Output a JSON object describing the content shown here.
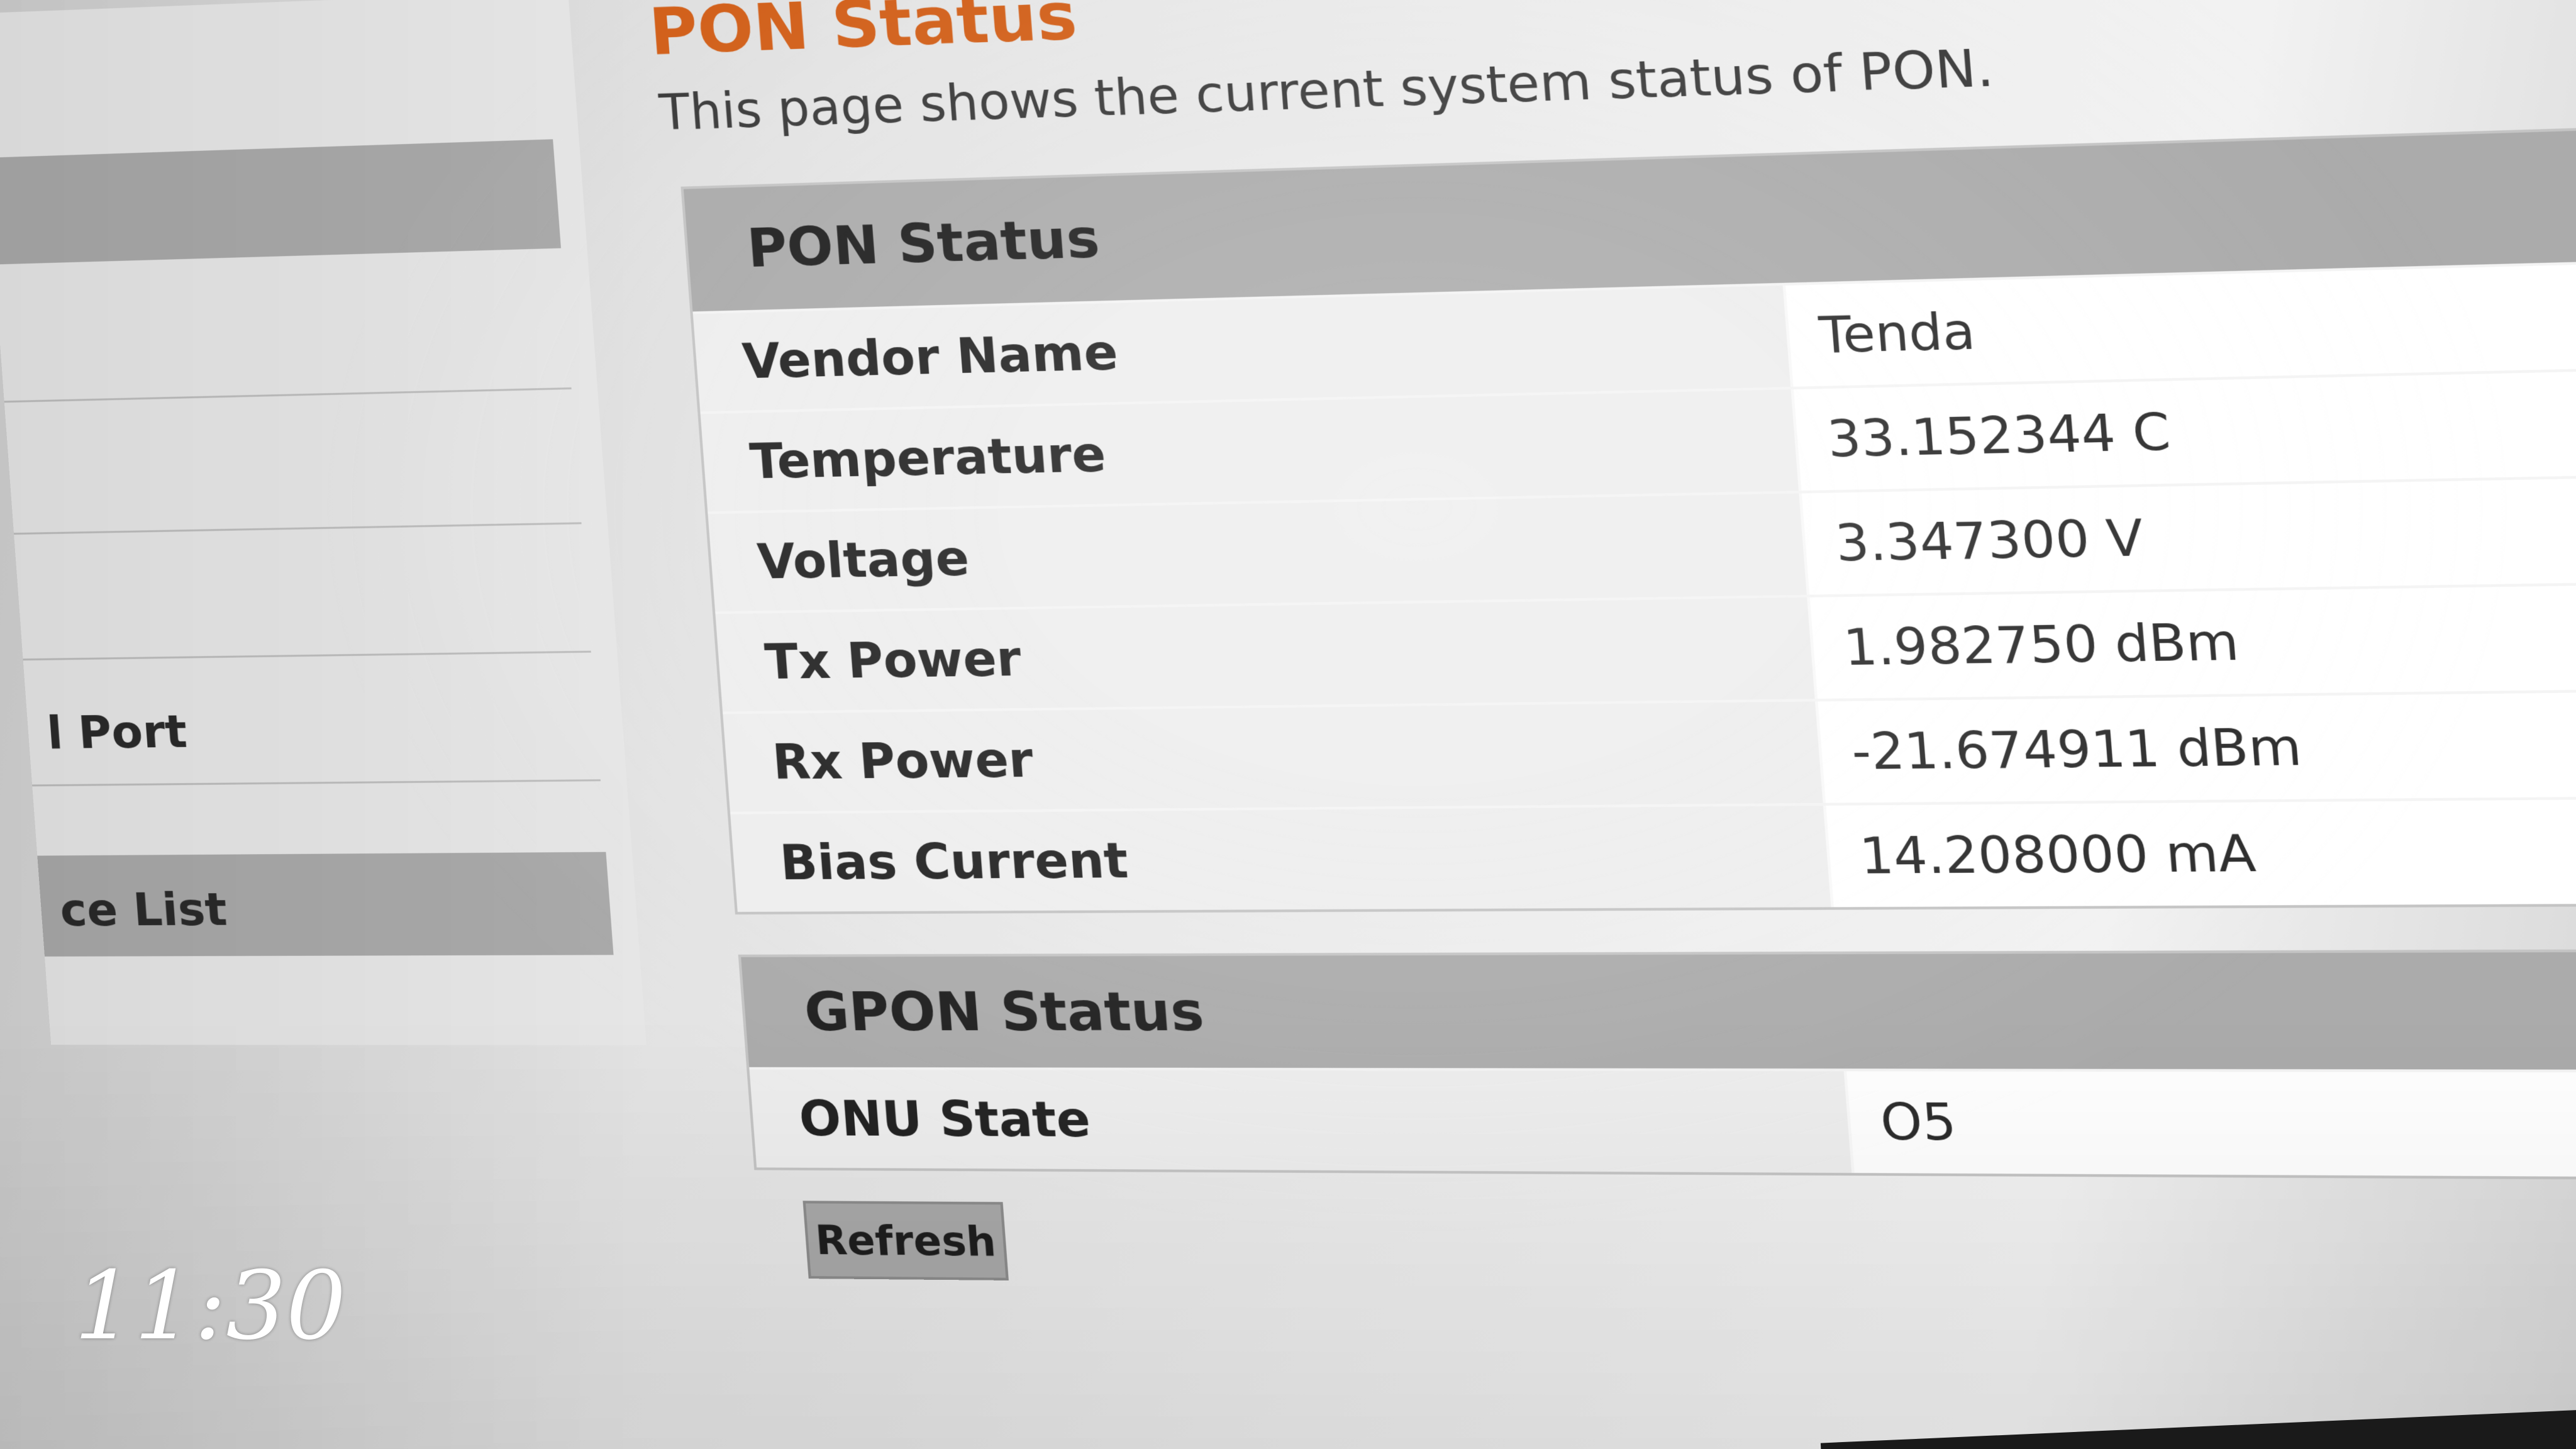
{
  "sidebar": {
    "items": [
      {
        "label": "",
        "active": true
      },
      {
        "label": "",
        "active": false
      },
      {
        "label": "",
        "active": false
      },
      {
        "label": "",
        "active": false
      },
      {
        "label": "l Port",
        "active": false
      },
      {
        "label": "ce List",
        "active": true
      }
    ]
  },
  "page": {
    "title": "PON Status",
    "description": "This page shows the current system status of PON."
  },
  "pon_status": {
    "heading": "PON Status",
    "rows": [
      {
        "label": "Vendor Name",
        "value": "Tenda"
      },
      {
        "label": "Temperature",
        "value": "33.152344 C"
      },
      {
        "label": "Voltage",
        "value": "3.347300 V"
      },
      {
        "label": "Tx Power",
        "value": "1.982750 dBm"
      },
      {
        "label": "Rx Power",
        "value": "-21.674911 dBm"
      },
      {
        "label": "Bias Current",
        "value": "14.208000 mA"
      }
    ]
  },
  "gpon_status": {
    "heading": "GPON Status",
    "rows": [
      {
        "label": "ONU State",
        "value": "O5"
      }
    ]
  },
  "actions": {
    "refresh_label": "Refresh"
  },
  "overlay": {
    "clock": "11:30"
  }
}
